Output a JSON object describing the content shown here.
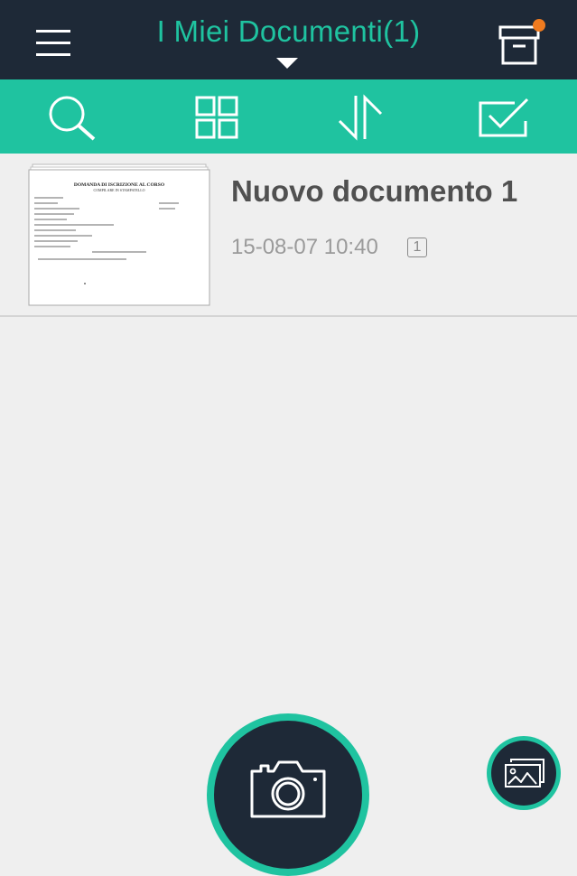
{
  "header": {
    "title": "I Miei Documenti(1)",
    "menu_icon": "hamburger-menu-icon",
    "archive_icon": "archive-box-icon",
    "notification_color": "#f07b1f"
  },
  "toolbar": {
    "icons": [
      "search-icon",
      "grid-view-icon",
      "sort-icon",
      "select-checkbox-icon"
    ]
  },
  "documents": [
    {
      "title": "Nuovo documento 1",
      "date": "15-08-07 10:40",
      "pages": "1",
      "thumbnail_heading": "DOMANDA DI ISCRIZIONE AL CORSO",
      "thumbnail_subheading": "COMPILARE IN STAMPATELLO"
    }
  ],
  "actions": {
    "camera_icon": "camera-icon",
    "gallery_icon": "gallery-import-icon"
  },
  "colors": {
    "header_bg": "#1e2937",
    "accent": "#1fc3a0",
    "background": "#efefef"
  }
}
